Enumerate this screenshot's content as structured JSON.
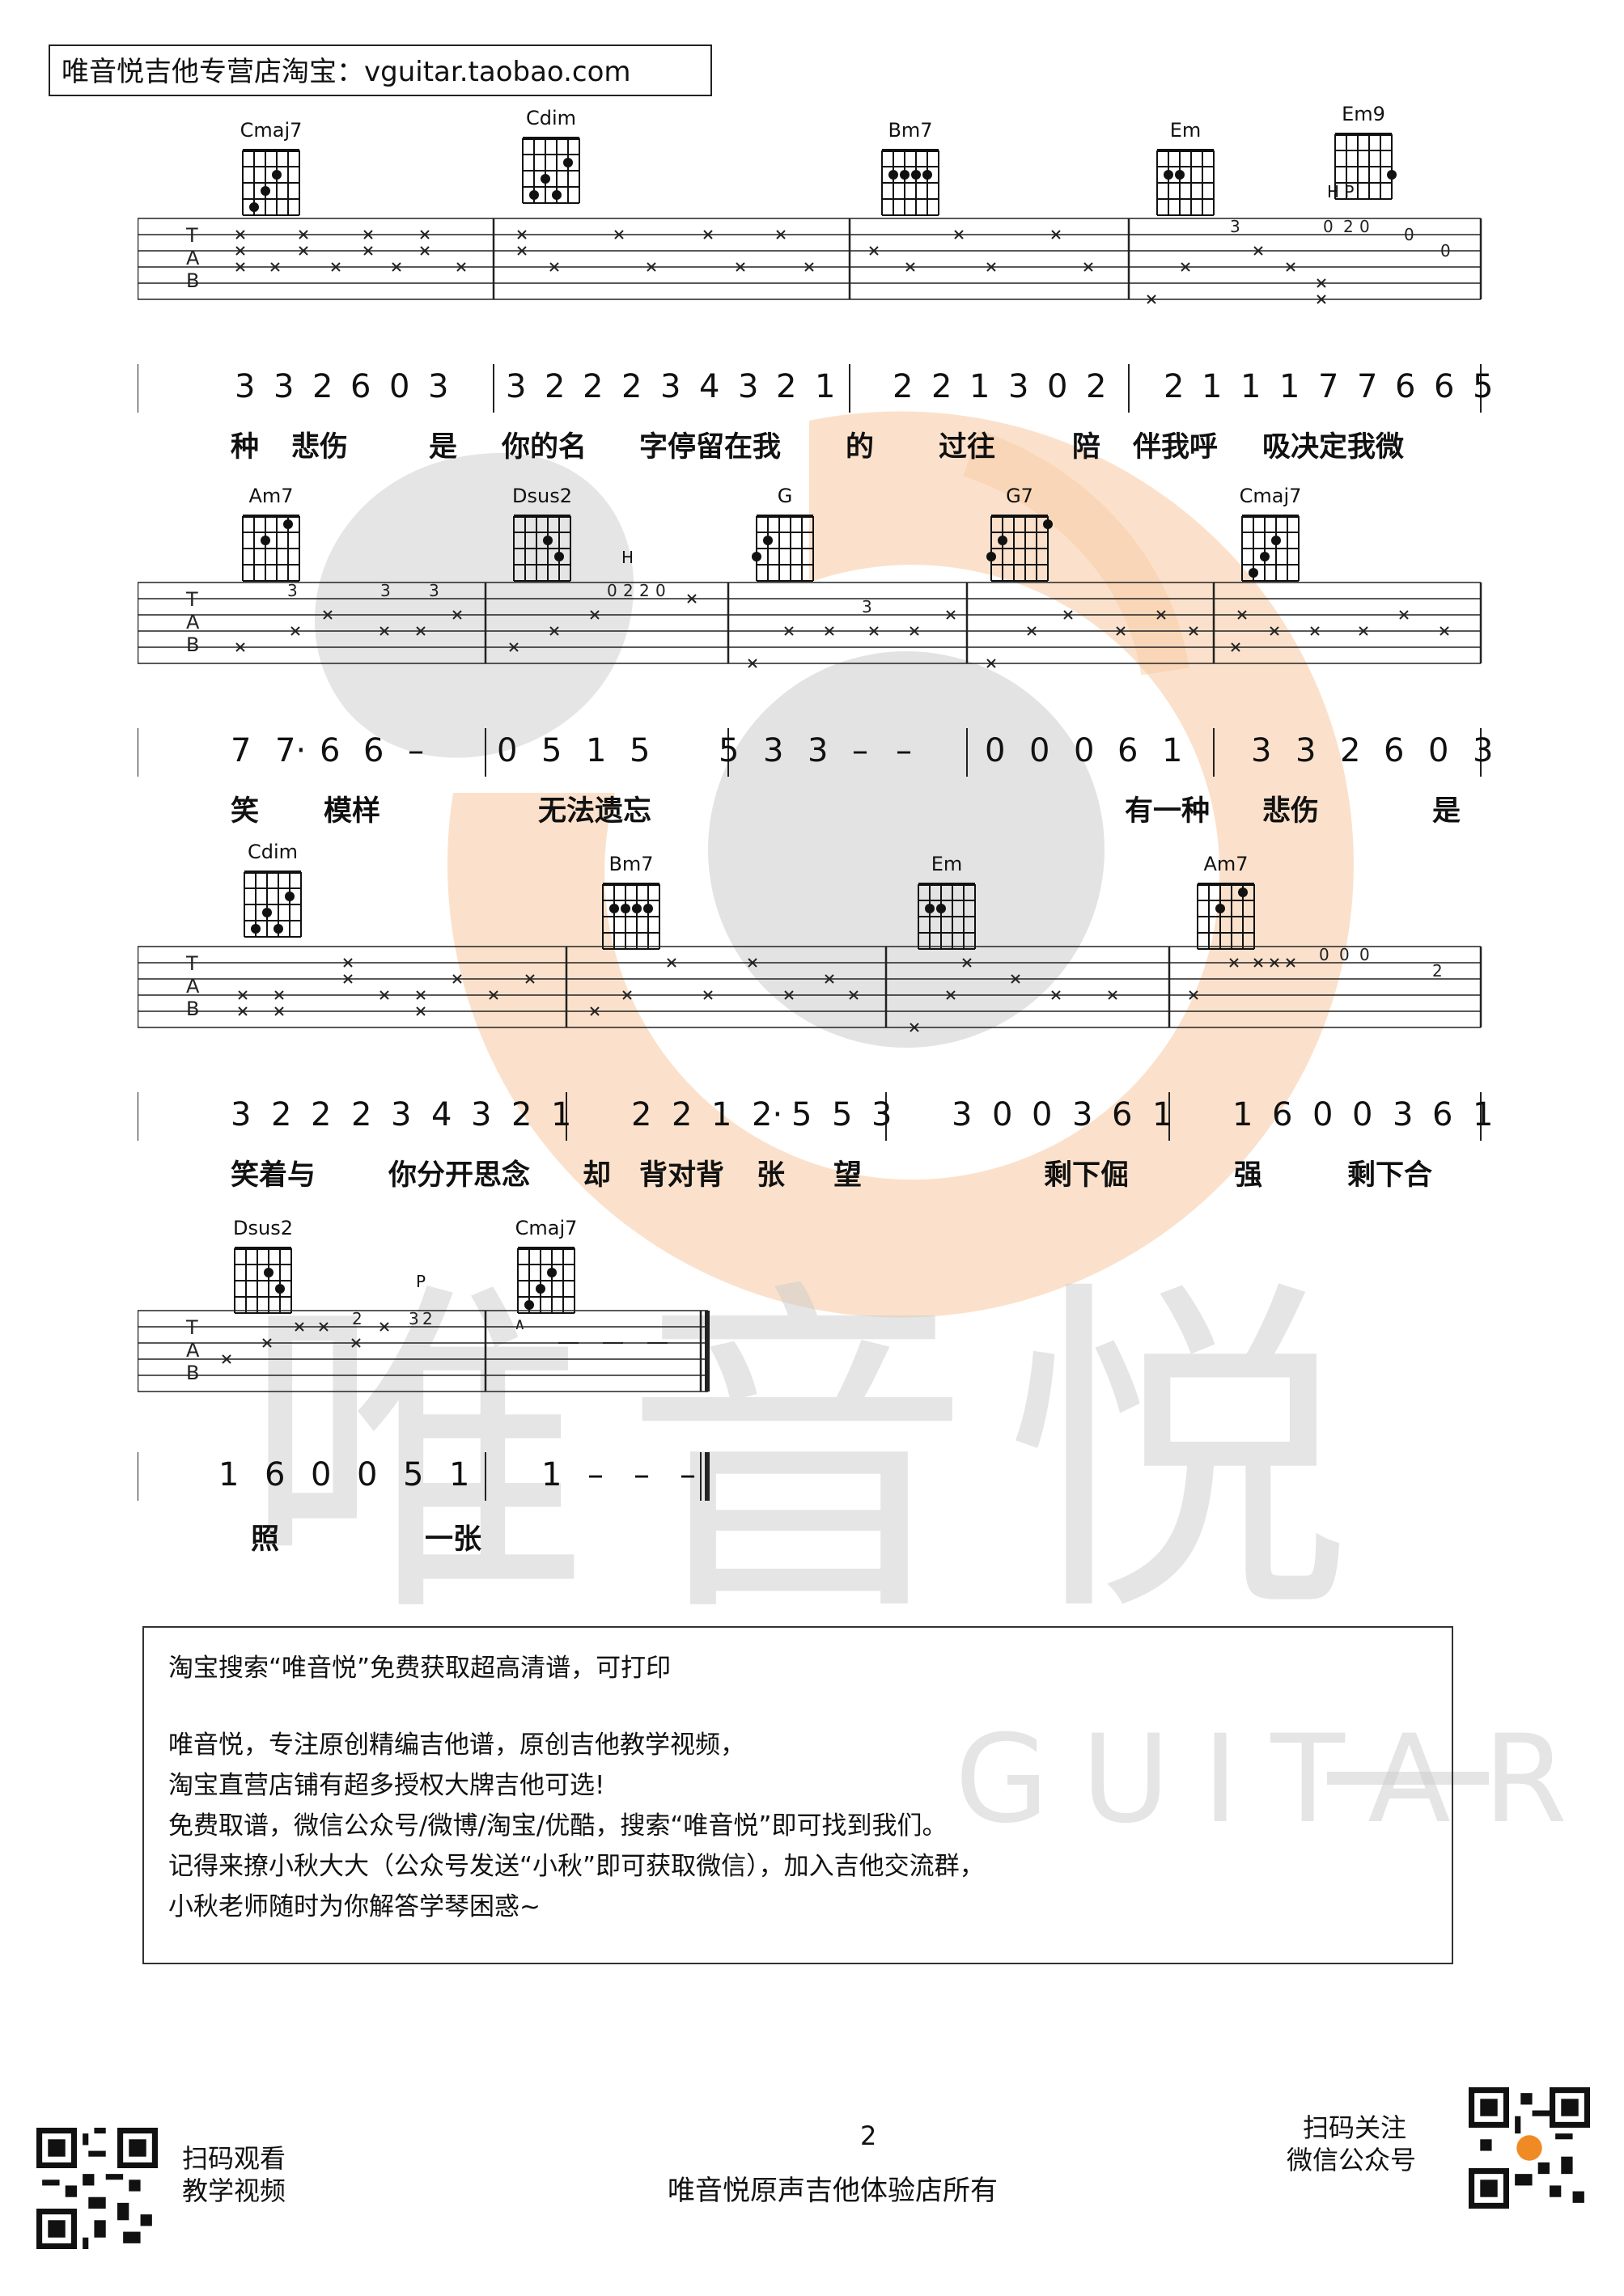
{
  "header": {
    "text": "唯音悦吉他专营店淘宝：vguitar.taobao.com"
  },
  "watermark": {
    "big_text": "唯音悦",
    "sub_text": "GUITAR",
    "colors": {
      "orange": "#f7c9a0",
      "gray": "#d5d5d5"
    }
  },
  "systems": [
    {
      "chords": [
        "Cmaj7",
        "Cdim",
        "Bm7",
        "Em",
        "Em9"
      ],
      "techniques": [
        "H P"
      ],
      "numbers": [
        "3",
        "3",
        "2",
        "6",
        "0",
        "3",
        "|",
        "3",
        "2",
        "2",
        "2",
        "3",
        "4",
        "3",
        "2",
        "1",
        "|",
        "2",
        "2",
        "1",
        "3",
        "0",
        "2",
        "|",
        "2",
        "1",
        "1",
        "1",
        "7",
        "7",
        "6",
        "6",
        "5"
      ],
      "lyrics": [
        "种",
        "悲伤",
        "是",
        "你的名",
        "字停留在我",
        "的",
        "过往",
        "陪",
        "伴我呼",
        "吸决定我微"
      ]
    },
    {
      "chords": [
        "Am7",
        "Dsus2",
        "G",
        "G7",
        "Cmaj7"
      ],
      "techniques": [
        "H"
      ],
      "numbers": [
        "7",
        "7·",
        "6",
        "6",
        "–",
        "|",
        "0",
        "5",
        "1",
        "5",
        "|",
        "5",
        "3",
        "3",
        "–",
        "–",
        "|",
        "0",
        "0",
        "0",
        "6",
        "1",
        "|",
        "3",
        "3",
        "2",
        "6",
        "0",
        "3"
      ],
      "lyrics": [
        "笑",
        "模样",
        "无法遗忘",
        "有一种",
        "悲伤",
        "是"
      ]
    },
    {
      "chords": [
        "Cdim",
        "Bm7",
        "Em",
        "Am7"
      ],
      "techniques": [],
      "numbers": [
        "3",
        "2",
        "2",
        "2",
        "3",
        "4",
        "3",
        "2",
        "1",
        "|",
        "2",
        "2",
        "1",
        "2·",
        "5",
        "5",
        "3",
        "|",
        "3",
        "0",
        "0",
        "3",
        "6",
        "1",
        "|",
        "1",
        "6",
        "0",
        "0",
        "3",
        "6",
        "1"
      ],
      "lyrics": [
        "笑着与",
        "你分开思念",
        "却",
        "背对背",
        "张",
        "望",
        "剩下倔",
        "强",
        "剩下合"
      ]
    },
    {
      "chords": [
        "Dsus2",
        "Cmaj7"
      ],
      "techniques": [
        "P"
      ],
      "numbers": [
        "1",
        "6",
        "0",
        "0",
        "5",
        "1",
        "|",
        "1",
        "–",
        "–",
        "–"
      ],
      "lyrics": [
        "照",
        "一张"
      ]
    }
  ],
  "notes": {
    "line1": "淘宝搜索“唯音悦”免费获取超高清谱，可打印",
    "line2": "唯音悦，专注原创精编吉他谱，原创吉他教学视频，",
    "line3": "淘宝直营店铺有超多授权大牌吉他可选!",
    "line4": "免费取谱，微信公众号/微博/淘宝/优酷，搜索“唯音悦”即可找到我们。",
    "line5": "记得来撩小秋大大（公众号发送“小秋”即可获取微信），加入吉他交流群，",
    "line6": "小秋老师随时为你解答学琴困惑~"
  },
  "footer": {
    "left_qr_label_1": "扫码观看",
    "left_qr_label_2": "教学视频",
    "page_number": "2",
    "center_text": "唯音悦原声吉他体验店所有",
    "right_qr_label_1": "扫码关注",
    "right_qr_label_2": "微信公众号"
  }
}
